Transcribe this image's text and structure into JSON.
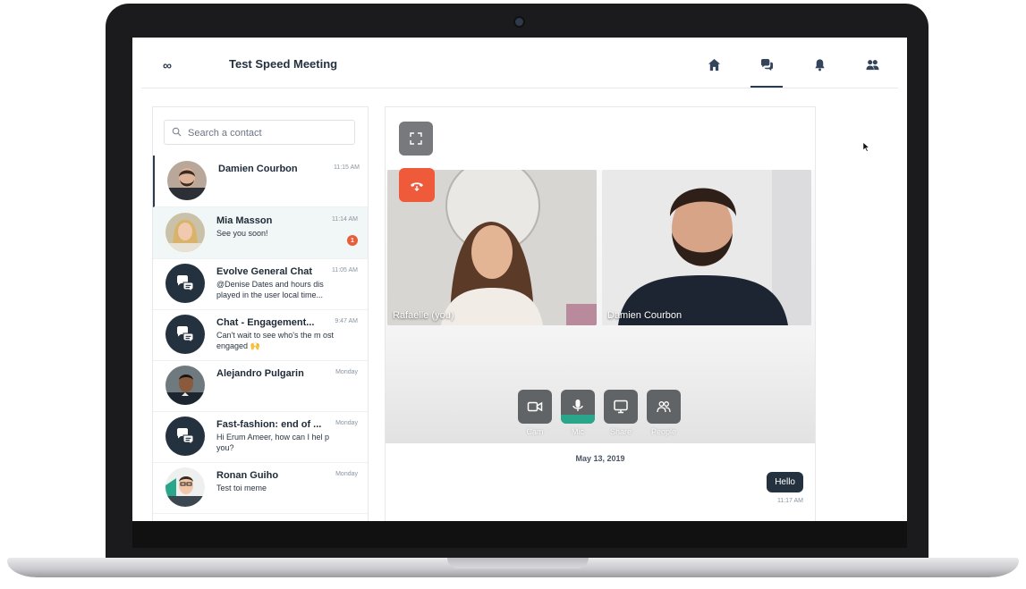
{
  "header": {
    "logo": "∞",
    "title": "Test Speed Meeting",
    "nav": [
      {
        "name": "home",
        "icon": "home-icon"
      },
      {
        "name": "chat",
        "icon": "chat-icon",
        "active": true
      },
      {
        "name": "notifications",
        "icon": "bell-icon"
      },
      {
        "name": "people",
        "icon": "people-icon"
      }
    ]
  },
  "search": {
    "placeholder": "Search a contact"
  },
  "contacts": [
    {
      "name": "Damien Courbon",
      "time": "11:15 AM",
      "message": "",
      "avatar": "photo",
      "selected": true
    },
    {
      "name": "Mia Masson",
      "time": "11:14 AM",
      "message": "See you soon!",
      "avatar": "photo",
      "unread": "1"
    },
    {
      "name": "Evolve General Chat",
      "time": "11:05 AM",
      "message": "@Denise Dates and hours dis played in the user local time...",
      "avatar": "group-chat-icon"
    },
    {
      "name": "Chat - Engagement...",
      "time": "9:47 AM",
      "message": "Can't wait to see who's the m ost engaged 🙌",
      "avatar": "group-chat-icon"
    },
    {
      "name": "Alejandro Pulgarin",
      "time": "Monday",
      "message": "",
      "avatar": "photo"
    },
    {
      "name": "Fast-fashion: end of ...",
      "time": "Monday",
      "message": "Hi Erum Ameer, how can I hel p you?",
      "avatar": "group-chat-icon"
    },
    {
      "name": "Ronan Guiho",
      "time": "Monday",
      "message": "Test toi meme",
      "avatar": "photo"
    }
  ],
  "meeting": {
    "participants": [
      {
        "label": "Rafaelle (you)"
      },
      {
        "label": "Damien Courbon"
      }
    ],
    "controls": [
      {
        "label": "Cam",
        "icon": "camera-icon"
      },
      {
        "label": "Mic",
        "icon": "microphone-icon",
        "active": true
      },
      {
        "label": "Share",
        "icon": "screen-share-icon"
      },
      {
        "label": "People",
        "icon": "people-icon"
      }
    ],
    "date": "May 13, 2019",
    "messages": [
      {
        "text": "Hello",
        "time": "11:17 AM",
        "from": "me"
      }
    ]
  },
  "colors": {
    "accent_dark": "#24313f",
    "hangup": "#ef5b3a",
    "mic_active": "#2aa68a",
    "badge": "#e85d3b"
  }
}
